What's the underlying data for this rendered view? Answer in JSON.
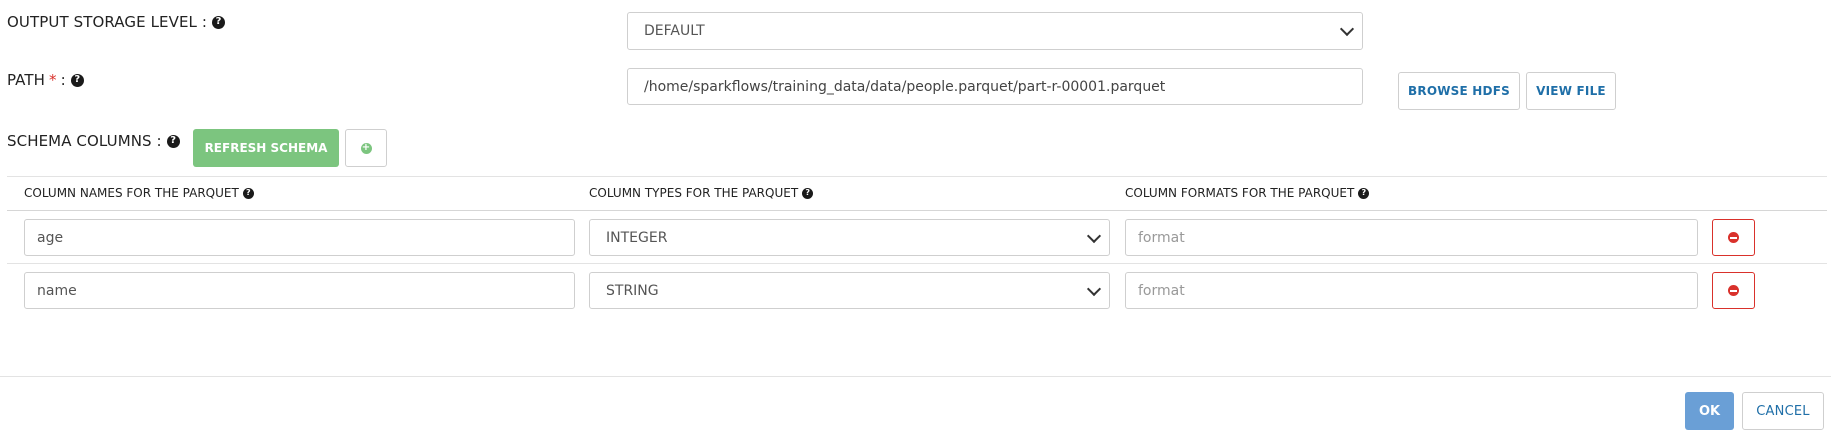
{
  "output_storage": {
    "label": "OUTPUT STORAGE LEVEL :",
    "value": "DEFAULT",
    "help_icon": "question-circle-icon"
  },
  "path": {
    "label": "PATH",
    "required_mark": "*",
    "colon": ":",
    "value": "/home/sparkflows/training_data/data/people.parquet/part-r-00001.parquet",
    "browse_label": "BROWSE HDFS",
    "view_label": "VIEW FILE"
  },
  "schema": {
    "label": "SCHEMA COLUMNS :",
    "refresh_label": "REFRESH SCHEMA",
    "add_icon": "plus-circle-icon"
  },
  "table": {
    "headers": [
      "COLUMN NAMES FOR THE PARQUET",
      "COLUMN TYPES FOR THE PARQUET",
      "COLUMN FORMATS FOR THE PARQUET"
    ],
    "rows": [
      {
        "name": "age",
        "type": "INTEGER",
        "format_placeholder": "format"
      },
      {
        "name": "name",
        "type": "STRING",
        "format_placeholder": "format"
      }
    ]
  },
  "footer": {
    "ok_label": "OK",
    "cancel_label": "CANCEL"
  },
  "colors": {
    "accent_blue": "#6a9fd6",
    "link_blue": "#1f6fa8",
    "green": "#7cc57f",
    "danger": "#d9312b"
  }
}
